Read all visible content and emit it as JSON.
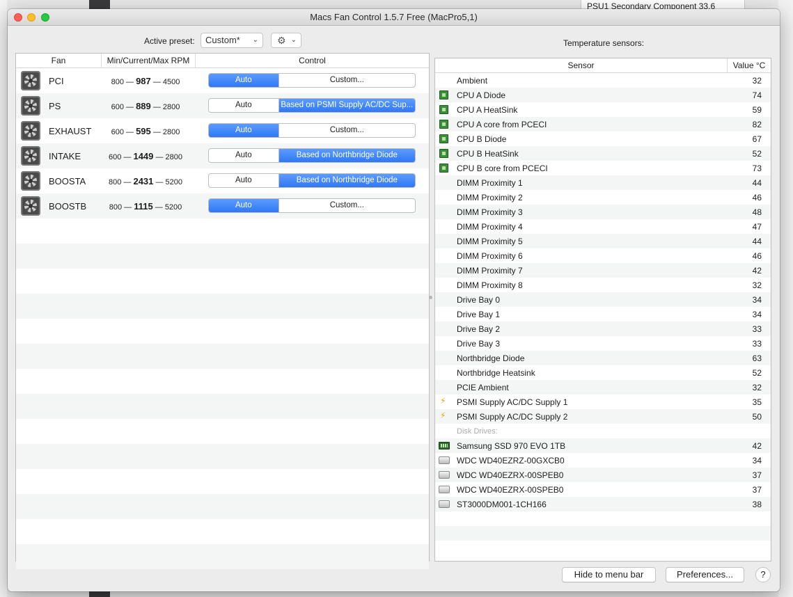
{
  "window": {
    "title": "Macs Fan Control 1.5.7 Free (MacPro5,1)"
  },
  "background": {
    "psu_label": "PSU1 Secondary Component   33.6"
  },
  "toolbar": {
    "preset_label": "Active preset:",
    "preset_value": "Custom*",
    "gear_icon": "gear-icon"
  },
  "fans": {
    "headers": {
      "fan": "Fan",
      "rpm": "Min/Current/Max RPM",
      "control": "Control"
    },
    "rows": [
      {
        "name": "PCI",
        "min": "800",
        "current": "987",
        "max": "4500",
        "auto_label": "Auto",
        "custom_label": "Custom...",
        "mode": "auto"
      },
      {
        "name": "PS",
        "min": "600",
        "current": "889",
        "max": "2800",
        "auto_label": "Auto",
        "custom_label": "Based on PSMI Supply AC/DC Sup...",
        "mode": "custom"
      },
      {
        "name": "EXHAUST",
        "min": "600",
        "current": "595",
        "max": "2800",
        "auto_label": "Auto",
        "custom_label": "Custom...",
        "mode": "auto"
      },
      {
        "name": "INTAKE",
        "min": "600",
        "current": "1449",
        "max": "2800",
        "auto_label": "Auto",
        "custom_label": "Based on Northbridge Diode",
        "mode": "custom"
      },
      {
        "name": "BOOSTA",
        "min": "800",
        "current": "2431",
        "max": "5200",
        "auto_label": "Auto",
        "custom_label": "Based on Northbridge Diode",
        "mode": "custom"
      },
      {
        "name": "BOOSTB",
        "min": "800",
        "current": "1115",
        "max": "5200",
        "auto_label": "Auto",
        "custom_label": "Custom...",
        "mode": "auto"
      }
    ]
  },
  "sensors": {
    "title": "Temperature sensors:",
    "headers": {
      "sensor": "Sensor",
      "value": "Value °C"
    },
    "rows": [
      {
        "icon": "none",
        "name": "Ambient",
        "value": "32"
      },
      {
        "icon": "cpu",
        "name": "CPU A Diode",
        "value": "74"
      },
      {
        "icon": "cpu",
        "name": "CPU A HeatSink",
        "value": "59"
      },
      {
        "icon": "cpu",
        "name": "CPU A core from PCECI",
        "value": "82"
      },
      {
        "icon": "cpu",
        "name": "CPU B Diode",
        "value": "67"
      },
      {
        "icon": "cpu",
        "name": "CPU B HeatSink",
        "value": "52"
      },
      {
        "icon": "cpu",
        "name": "CPU B core from PCECI",
        "value": "73"
      },
      {
        "icon": "none",
        "name": "DIMM Proximity 1",
        "value": "44"
      },
      {
        "icon": "none",
        "name": "DIMM Proximity 2",
        "value": "46"
      },
      {
        "icon": "none",
        "name": "DIMM Proximity 3",
        "value": "48"
      },
      {
        "icon": "none",
        "name": "DIMM Proximity 4",
        "value": "47"
      },
      {
        "icon": "none",
        "name": "DIMM Proximity 5",
        "value": "44"
      },
      {
        "icon": "none",
        "name": "DIMM Proximity 6",
        "value": "46"
      },
      {
        "icon": "none",
        "name": "DIMM Proximity 7",
        "value": "42"
      },
      {
        "icon": "none",
        "name": "DIMM Proximity 8",
        "value": "32"
      },
      {
        "icon": "none",
        "name": "Drive Bay 0",
        "value": "34"
      },
      {
        "icon": "none",
        "name": "Drive Bay 1",
        "value": "34"
      },
      {
        "icon": "none",
        "name": "Drive Bay 2",
        "value": "33"
      },
      {
        "icon": "none",
        "name": "Drive Bay 3",
        "value": "33"
      },
      {
        "icon": "none",
        "name": "Northbridge Diode",
        "value": "63"
      },
      {
        "icon": "none",
        "name": "Northbridge Heatsink",
        "value": "52"
      },
      {
        "icon": "none",
        "name": "PCIE Ambient",
        "value": "32"
      },
      {
        "icon": "bolt",
        "name": "PSMI Supply AC/DC Supply 1",
        "value": "35"
      },
      {
        "icon": "bolt",
        "name": "PSMI Supply AC/DC Supply 2",
        "value": "50"
      },
      {
        "icon": "group",
        "name": "Disk Drives:",
        "value": ""
      },
      {
        "icon": "ssd",
        "name": "Samsung SSD 970 EVO 1TB",
        "value": "42"
      },
      {
        "icon": "hdd",
        "name": "WDC WD40EZRZ-00GXCB0",
        "value": "34"
      },
      {
        "icon": "hdd",
        "name": "WDC WD40EZRX-00SPEB0",
        "value": "37"
      },
      {
        "icon": "hdd",
        "name": "WDC WD40EZRX-00SPEB0",
        "value": "37"
      },
      {
        "icon": "hdd",
        "name": "ST3000DM001-1CH166",
        "value": "38"
      }
    ]
  },
  "footer": {
    "hide_label": "Hide to menu bar",
    "prefs_label": "Preferences...",
    "help_label": "?"
  },
  "colors": {
    "accent": "#2f78f5",
    "cpu_icon": "#3b8f3b",
    "bolt_icon": "#e6a700"
  }
}
